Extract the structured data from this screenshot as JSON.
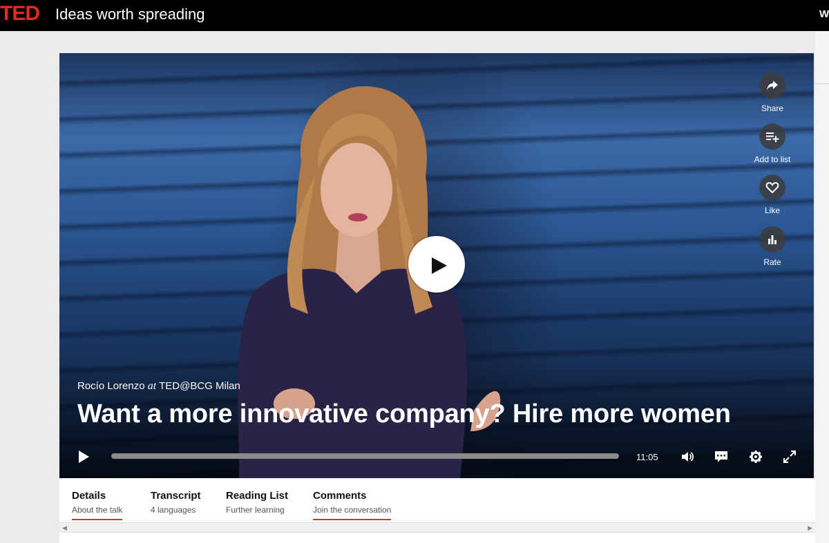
{
  "header": {
    "logo": "TED",
    "tagline": "Ideas worth spreading",
    "corner_text": "W..."
  },
  "player": {
    "speaker": "Rocío Lorenzo",
    "at": "at",
    "event": "TED@BCG Milan",
    "title": "Want a more innovative company? Hire more women",
    "duration": "11:05",
    "progress_fraction": 0,
    "actions": [
      {
        "label": "Share",
        "icon": "share-icon"
      },
      {
        "label": "Add to list",
        "icon": "playlist-add-icon"
      },
      {
        "label": "Like",
        "icon": "heart-icon"
      },
      {
        "label": "Rate",
        "icon": "bar-chart-icon"
      }
    ],
    "controls": [
      "play-icon",
      "volume-icon",
      "captions-icon",
      "settings-icon",
      "fullscreen-icon"
    ]
  },
  "tabs": [
    {
      "title": "Details",
      "subtitle": "About the talk",
      "active": true
    },
    {
      "title": "Transcript",
      "subtitle": "4 languages",
      "active": false
    },
    {
      "title": "Reading List",
      "subtitle": "Further learning",
      "active": false
    },
    {
      "title": "Comments",
      "subtitle": "Join the conversation",
      "active": true
    }
  ],
  "colors": {
    "accent": "#e62b1e",
    "header_bg": "#000000",
    "page_bg": "#ebebeb"
  }
}
